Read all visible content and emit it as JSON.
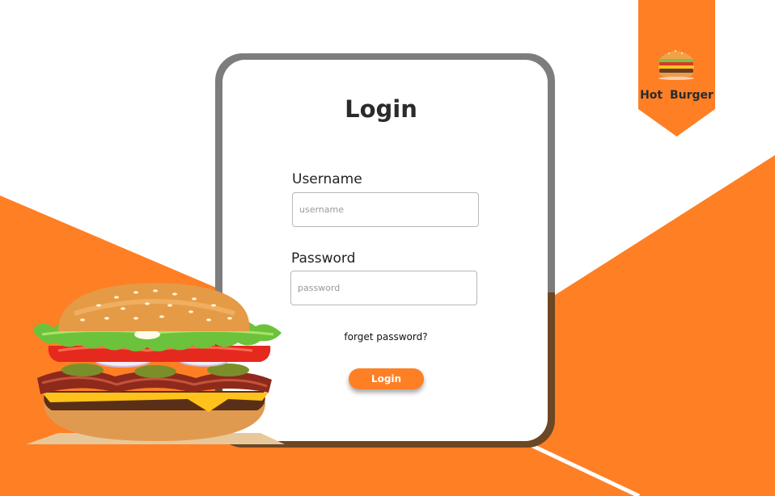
{
  "brand": {
    "name": "Hot  Burger",
    "icon": "burger-icon",
    "color": "#ff7f24"
  },
  "login": {
    "title": "Login",
    "username_label": "Username",
    "username_placeholder": "username",
    "username_value": "",
    "password_label": "Password",
    "password_placeholder": "password",
    "password_value": "",
    "forget_link": "forget password?",
    "submit_label": "Login"
  },
  "theme": {
    "accent": "#ff7f24",
    "card_border": "#7d7d7d",
    "background": "#ffffff"
  },
  "illustration": {
    "icon": "burger-illustration"
  }
}
